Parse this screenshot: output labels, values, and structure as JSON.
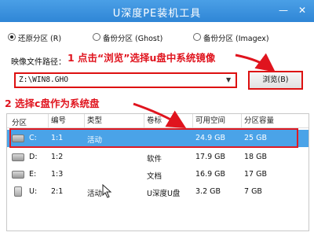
{
  "window": {
    "title": "U深度PE装机工具",
    "minimize_icon": "minimize-icon",
    "close_icon": "close-icon"
  },
  "modes": [
    {
      "label": "还原分区 (R)",
      "selected": true
    },
    {
      "label": "备份分区 (Ghost)",
      "selected": false
    },
    {
      "label": "备份分区 (Imagex)",
      "selected": false
    }
  ],
  "image_path": {
    "label": "映像文件路径：",
    "value": "Z:\\WIN8.GHO",
    "browse_label": "浏览(B)"
  },
  "annotations": {
    "step1": "1 点击“浏览”选择u盘中系统镜像",
    "step2": "2 选择c盘作为系统盘",
    "color": "#e0141e"
  },
  "table": {
    "headers": [
      "分区",
      "编号",
      "类型",
      "卷标",
      "可用空间",
      "分区容量"
    ],
    "rows": [
      {
        "partition": "C:",
        "number": "1:1",
        "type": "活动",
        "label": "",
        "free": "24.9 GB",
        "size": "25 GB",
        "icon": "disk-icon",
        "selected": true
      },
      {
        "partition": "D:",
        "number": "1:2",
        "type": "",
        "label": "软件",
        "free": "17.9 GB",
        "size": "18 GB",
        "icon": "disk-icon",
        "selected": false
      },
      {
        "partition": "E:",
        "number": "1:3",
        "type": "",
        "label": "文档",
        "free": "16.9 GB",
        "size": "17 GB",
        "icon": "disk-icon",
        "selected": false
      },
      {
        "partition": "U:",
        "number": "2:1",
        "type": "活动",
        "label": "U深度U盘",
        "free": "3.2 GB",
        "size": "7 GB",
        "icon": "usb-icon",
        "selected": false
      }
    ]
  },
  "colors": {
    "titlebar": "#2f86d6",
    "selection": "#4aa3e8",
    "highlight": "#e01a22"
  }
}
